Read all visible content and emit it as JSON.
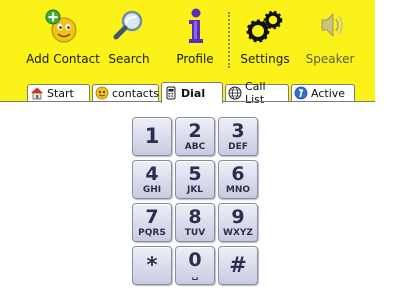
{
  "toolbar": {
    "items": [
      {
        "label": "Add Contact",
        "icon": "add-contact-smiley-icon",
        "disabled": false
      },
      {
        "label": "Search",
        "icon": "search-magnifier-icon",
        "disabled": false
      },
      {
        "label": "Profile",
        "icon": "info-icon",
        "disabled": false
      },
      {
        "label": "Settings",
        "icon": "gears-icon",
        "disabled": false
      },
      {
        "label": "Speaker",
        "icon": "speaker-icon",
        "disabled": true
      }
    ]
  },
  "tabs": [
    {
      "label": "Start",
      "icon": "home-icon",
      "active": false
    },
    {
      "label": "contacts",
      "icon": "contacts-smiley-icon",
      "active": false
    },
    {
      "label": "Dial",
      "icon": "phone-keypad-icon",
      "active": true
    },
    {
      "label": "Call List",
      "icon": "globe-icon",
      "active": false
    },
    {
      "label": "Active",
      "icon": "active-call-icon",
      "active": false
    }
  ],
  "dialpad": {
    "keys": [
      {
        "main": "1",
        "sub": ""
      },
      {
        "main": "2",
        "sub": "ABC"
      },
      {
        "main": "3",
        "sub": "DEF"
      },
      {
        "main": "4",
        "sub": "GHI"
      },
      {
        "main": "5",
        "sub": "JKL"
      },
      {
        "main": "6",
        "sub": "MNO"
      },
      {
        "main": "7",
        "sub": "PQRS"
      },
      {
        "main": "8",
        "sub": "TUV"
      },
      {
        "main": "9",
        "sub": "WXYZ"
      },
      {
        "main": "*",
        "sub": ""
      },
      {
        "main": "0",
        "sub": "␣"
      },
      {
        "main": "#",
        "sub": ""
      }
    ]
  },
  "colors": {
    "toolbar_bg": "#fbf21a",
    "key_text": "#2b2f4e",
    "key_border": "#8a8d9d"
  }
}
